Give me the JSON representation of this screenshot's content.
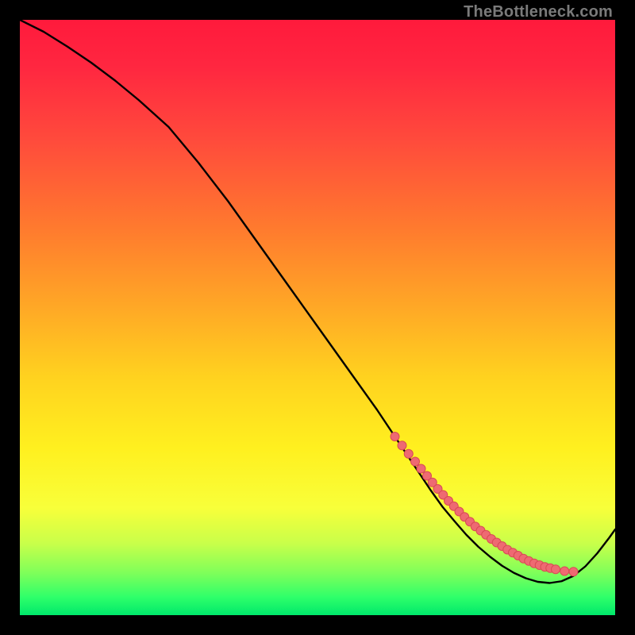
{
  "attribution": "TheBottleneck.com",
  "colors": {
    "background": "#000000",
    "gradient_top": "#ff1a3c",
    "gradient_bottom": "#00e86b",
    "curve": "#000000",
    "marker_fill": "#ee6a72",
    "marker_stroke": "#d94a55"
  },
  "chart_data": {
    "type": "line",
    "title": "",
    "xlabel": "",
    "ylabel": "",
    "xlim": [
      0,
      100
    ],
    "ylim": [
      0,
      100
    ],
    "series": [
      {
        "name": "curve",
        "x": [
          0,
          4,
          8,
          12,
          16,
          20,
          25,
          30,
          35,
          40,
          45,
          50,
          55,
          60,
          64,
          67,
          69,
          71,
          73,
          75,
          77,
          79,
          81,
          83,
          85,
          87,
          89,
          91,
          93,
          95,
          97,
          99,
          100
        ],
        "y": [
          100,
          98,
          95.5,
          92.8,
          89.8,
          86.5,
          82,
          76,
          69.5,
          62.5,
          55.5,
          48.5,
          41.5,
          34.5,
          28.5,
          24,
          21,
          18.2,
          15.8,
          13.5,
          11.5,
          9.8,
          8.3,
          7.1,
          6.2,
          5.6,
          5.4,
          5.7,
          6.6,
          8.2,
          10.4,
          13,
          14.4
        ]
      }
    ],
    "markers": {
      "name": "highlight-dots",
      "x": [
        63,
        64.2,
        65.3,
        66.4,
        67.4,
        68.4,
        69.3,
        70.2,
        71.1,
        72,
        72.9,
        73.8,
        74.7,
        75.6,
        76.5,
        77.4,
        78.3,
        79.2,
        80.1,
        81,
        81.9,
        82.8,
        83.7,
        84.6,
        85.5,
        86.4,
        87.3,
        88.2,
        89.1,
        90,
        91.5,
        93
      ],
      "y": [
        30,
        28.5,
        27.1,
        25.8,
        24.6,
        23.4,
        22.3,
        21.2,
        20.2,
        19.2,
        18.3,
        17.4,
        16.5,
        15.7,
        14.9,
        14.2,
        13.5,
        12.8,
        12.2,
        11.6,
        11.0,
        10.5,
        10.0,
        9.5,
        9.1,
        8.7,
        8.4,
        8.1,
        7.9,
        7.7,
        7.4,
        7.3
      ]
    }
  }
}
